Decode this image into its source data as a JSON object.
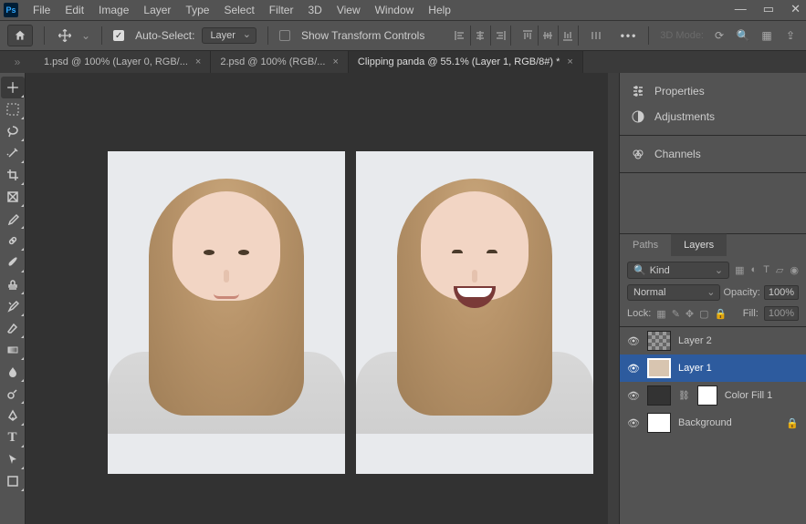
{
  "menu": {
    "items": [
      "File",
      "Edit",
      "Image",
      "Layer",
      "Type",
      "Select",
      "Filter",
      "3D",
      "View",
      "Window",
      "Help"
    ]
  },
  "options": {
    "auto_select_label": "Auto-Select:",
    "auto_select_target": "Layer",
    "show_transform_label": "Show Transform Controls",
    "mode3d_label": "3D Mode:"
  },
  "tabs": [
    {
      "label": "1.psd @ 100% (Layer 0, RGB/...",
      "active": false
    },
    {
      "label": "2.psd @ 100% (RGB/...",
      "active": false
    },
    {
      "label": "Clipping panda  @ 55.1% (Layer 1, RGB/8#) *",
      "active": true
    }
  ],
  "tools": [
    "move",
    "marquee",
    "lasso",
    "magic-wand",
    "crop",
    "frame",
    "eyedropper",
    "healing",
    "brush",
    "stamp",
    "history-brush",
    "eraser",
    "gradient",
    "blur",
    "dodge",
    "pen",
    "type",
    "path-select",
    "shape"
  ],
  "right": {
    "props_label": "Properties",
    "adjust_label": "Adjustments",
    "channels_label": "Channels",
    "paths_tab": "Paths",
    "layers_tab": "Layers",
    "kind_label": "Kind",
    "blend_mode": "Normal",
    "opacity_label": "Opacity:",
    "opacity_value": "100%",
    "lock_label": "Lock:",
    "fill_label": "Fill:",
    "fill_value": "100%",
    "layers": [
      {
        "name": "Layer 2",
        "selected": false,
        "thumb": "checker"
      },
      {
        "name": "Layer 1",
        "selected": true,
        "thumb": "photo"
      },
      {
        "name": "Color Fill 1",
        "selected": false,
        "thumb": "solid",
        "mask": true
      },
      {
        "name": "Background",
        "selected": false,
        "thumb": "white",
        "locked": true,
        "italic": true
      }
    ]
  }
}
